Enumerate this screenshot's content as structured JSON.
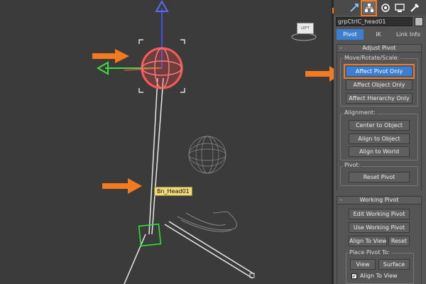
{
  "viewport": {
    "bone_label": "Bn_Head01",
    "view_cube_label": "LEFT"
  },
  "command_panel": {
    "tabs": [
      {
        "icon": "create-icon"
      },
      {
        "icon": "modify-icon"
      },
      {
        "icon": "hierarchy-icon"
      },
      {
        "icon": "motion-icon"
      },
      {
        "icon": "display-icon"
      },
      {
        "icon": "utilities-icon"
      }
    ],
    "object_name": "grpCtrlC_head01",
    "hierarchy_tabs": [
      "Pivot",
      "IK",
      "Link Info"
    ],
    "adjust_pivot": {
      "title": "Adjust Pivot",
      "move_group_label": "Move/Rotate/Scale:",
      "affect_pivot_only": "Affect Pivot Only",
      "affect_object_only": "Affect Object Only",
      "affect_hierarchy_only": "Affect Hierarchy Only",
      "alignment_label": "Alignment:",
      "center_to_object": "Center to Object",
      "align_to_object": "Align to Object",
      "align_to_world": "Align to World",
      "pivot_label": "Pivot:",
      "reset_pivot": "Reset Pivot"
    },
    "working_pivot": {
      "title": "Working Pivot",
      "edit_working_pivot": "Edit Working Pivot",
      "use_working_pivot": "Use Working Pivot",
      "align_to_view": "Align To View",
      "reset": "Reset",
      "place_pivot_label": "Place Pivot To:",
      "view": "View",
      "surface": "Surface",
      "align_to_view_check": "Align To View"
    },
    "rollout_minus": "-"
  },
  "colors": {
    "highlight": "#f47a20",
    "active_blue": "#3b7ed2"
  }
}
